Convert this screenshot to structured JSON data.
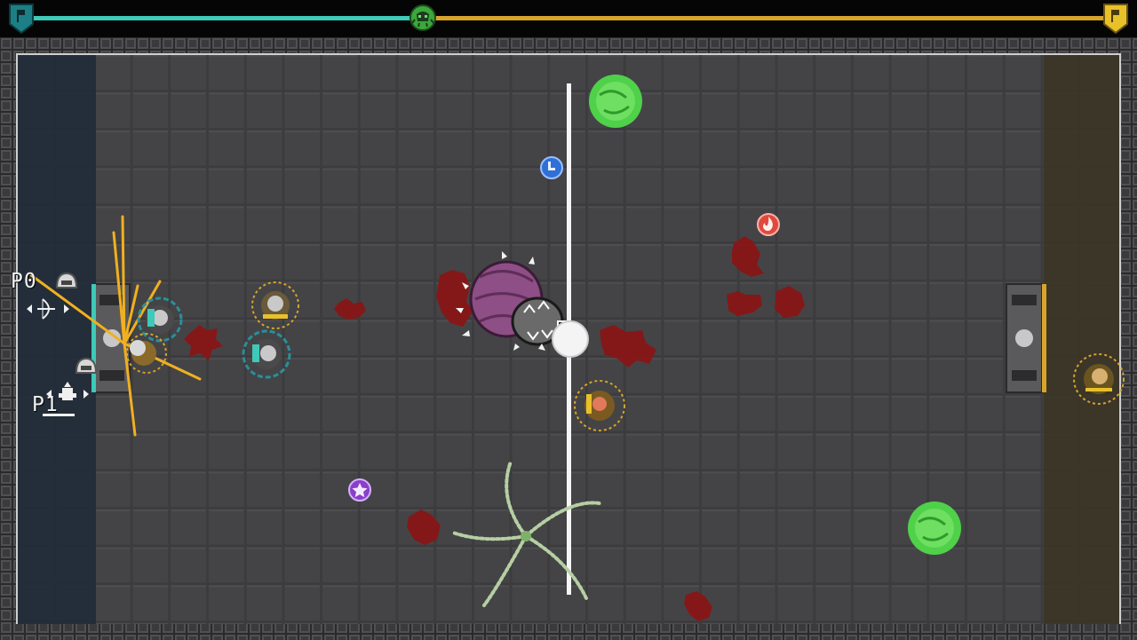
{
  "hud": {
    "team_left_color": "#3ec9b8",
    "team_right_color": "#d8a42a",
    "left_banner_icon": "team-flag-banner-icon",
    "right_banner_icon": "team-flag-banner-icon",
    "center_token_icon": "skull-ball-token-icon",
    "possession_fraction": 0.37
  },
  "players": [
    {
      "label": "P0",
      "avatar_icon": "helmet-avatar-icon",
      "control_icon": "bow-aim-icon"
    },
    {
      "label": "P1",
      "avatar_icon": "helmet-avatar-icon",
      "control_icon": "move-arrows-icon"
    }
  ],
  "arena": {
    "floor_color": "#3d3d3f",
    "left_endzone_color": "#1f2833",
    "right_endzone_color": "#3a3426",
    "midline_color": "#f5f5f5"
  },
  "pickups": [
    {
      "icon": "boot-speed-icon",
      "color": "#2e6fd8"
    },
    {
      "icon": "fire-power-icon",
      "color": "#e04a3e"
    },
    {
      "icon": "star-power-icon",
      "color": "#8a3fc8"
    }
  ],
  "hazards": [
    {
      "icon": "green-portal-icon",
      "color": "#4fd14a"
    },
    {
      "icon": "green-portal-icon",
      "color": "#4fd14a"
    },
    {
      "icon": "tentacle-vortex-icon",
      "color": "#a9c79a"
    }
  ],
  "boss": {
    "icon": "purple-worm-boss-icon",
    "color": "#8e4e86"
  }
}
